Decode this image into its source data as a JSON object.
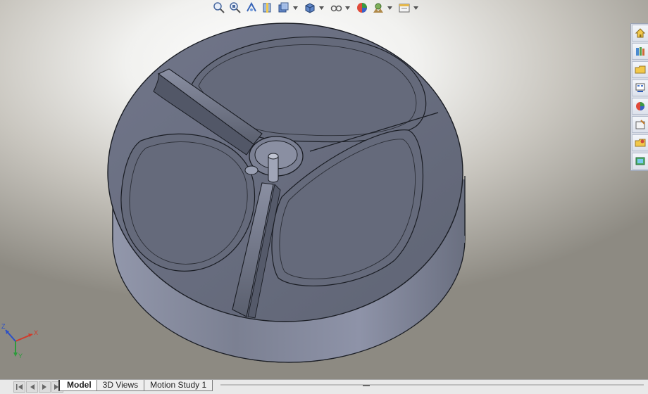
{
  "view_toolbar": {
    "buttons": [
      {
        "name": "zoom-to-fit-icon"
      },
      {
        "name": "zoom-to-area-icon"
      },
      {
        "name": "previous-view-icon"
      },
      {
        "name": "section-view-icon"
      },
      {
        "name": "view-orientation-icon",
        "dropdown": true
      },
      {
        "name": "display-style-icon",
        "dropdown": true
      },
      {
        "name": "hide-show-items-icon",
        "dropdown": true
      },
      {
        "name": "edit-appearance-icon"
      },
      {
        "name": "apply-scene-icon",
        "dropdown": true
      },
      {
        "name": "view-settings-icon",
        "dropdown": true
      }
    ]
  },
  "task_pane": {
    "buttons": [
      {
        "name": "solidworks-resources-icon"
      },
      {
        "name": "design-library-icon"
      },
      {
        "name": "file-explorer-icon"
      },
      {
        "name": "view-palette-icon"
      },
      {
        "name": "appearances-scenes-icon"
      },
      {
        "name": "custom-properties-icon"
      },
      {
        "name": "open-folder-icon"
      },
      {
        "name": "document-recovery-icon"
      }
    ]
  },
  "triad": {
    "x_label": "X",
    "y_label": "Y",
    "z_label": "Z"
  },
  "tabs": {
    "items": [
      "Model",
      "3D Views",
      "Motion Study 1"
    ],
    "active": "Model"
  },
  "colors": {
    "model_top": "#6c7180",
    "model_side": "#7b8092",
    "edge": "#1a1d24",
    "triad_x": "#d23a2a",
    "triad_y": "#2e9a3c",
    "triad_z": "#2a4fc8"
  }
}
